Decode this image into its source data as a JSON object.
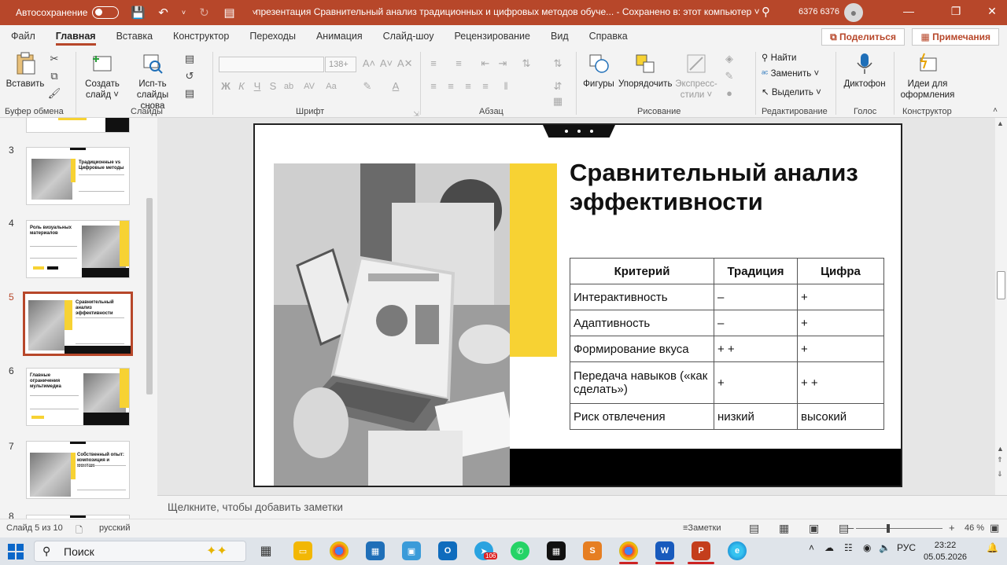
{
  "titlebar": {
    "autosave_label": "Автосохранение",
    "document_title": "презентация Сравнительный анализ традиционных и цифровых методов обуче...  -  Сохранено в: этот компьютер  ˅",
    "user_name": "6376 6376"
  },
  "ribbon_tabs": [
    "Файл",
    "Главная",
    "Вставка",
    "Конструктор",
    "Переходы",
    "Анимация",
    "Слайд-шоу",
    "Рецензирование",
    "Вид",
    "Справка"
  ],
  "ribbon_actions": {
    "share": "Поделиться",
    "comments": "Примечания"
  },
  "ribbon": {
    "clipboard": {
      "paste": "Вставить",
      "label": "Буфер обмена"
    },
    "slides": {
      "new_slide": "Создать слайд ˅",
      "reuse": "Исп-ть слайды снова",
      "label": "Слайды"
    },
    "font": {
      "font_size": "138+",
      "label": "Шрифт",
      "bold": "Ж",
      "italic": "К",
      "underline": "Ч",
      "strike": "S",
      "abc": "ab",
      "spacing": "AV",
      "case": "Aa"
    },
    "paragraph": {
      "label": "Абзац"
    },
    "drawing": {
      "shapes": "Фигуры",
      "arrange": "Упорядочить",
      "quick_styles": "Экспресс-стили ˅",
      "label": "Рисование"
    },
    "editing": {
      "find": "Найти",
      "replace": "Заменить",
      "select": "Выделить",
      "label": "Редактирование"
    },
    "voice": {
      "dictate": "Диктофон",
      "label": "Голос"
    },
    "designer": {
      "ideas": "Идеи для оформления",
      "label": "Конструктор"
    }
  },
  "thumbnails": [
    {
      "number": "3",
      "title": "Традиционные vs Цифровые методы"
    },
    {
      "number": "4",
      "title": "Роль визуальных материалов"
    },
    {
      "number": "5",
      "title": "Сравнительный анализ эффективности"
    },
    {
      "number": "6",
      "title": "Главные ограничения мультимедиа"
    },
    {
      "number": "7",
      "title": "Собственный опыт: композиция и монтаж"
    },
    {
      "number": "8",
      "title": ""
    }
  ],
  "slide": {
    "title": "Сравнительный анализ эффективности",
    "table": {
      "headers": [
        "Критерий",
        "Традиция",
        "Цифра"
      ],
      "rows": [
        [
          "Интерактивность",
          "–",
          "+"
        ],
        [
          "Адаптивность",
          "–",
          "+"
        ],
        [
          "Формирование вкуса",
          "+ +",
          "+"
        ],
        [
          "Передача навыков («как сделать»)",
          "+",
          "+ +"
        ],
        [
          "Риск отвлечения",
          "низкий",
          "высокий"
        ]
      ]
    }
  },
  "notes_placeholder": "Щелкните, чтобы добавить заметки",
  "statusbar": {
    "slide_info": "Слайд 5 из 10",
    "language": "русский",
    "notes_button": "Заметки",
    "zoom": "46 %"
  },
  "taskbar": {
    "search_label": "Поиск",
    "language": "РУС",
    "time": "23:22",
    "date": "05.05.2026",
    "telegram_badge": "106"
  },
  "colors": {
    "accent": "#b7472a",
    "slide_yellow": "#f7d233"
  }
}
